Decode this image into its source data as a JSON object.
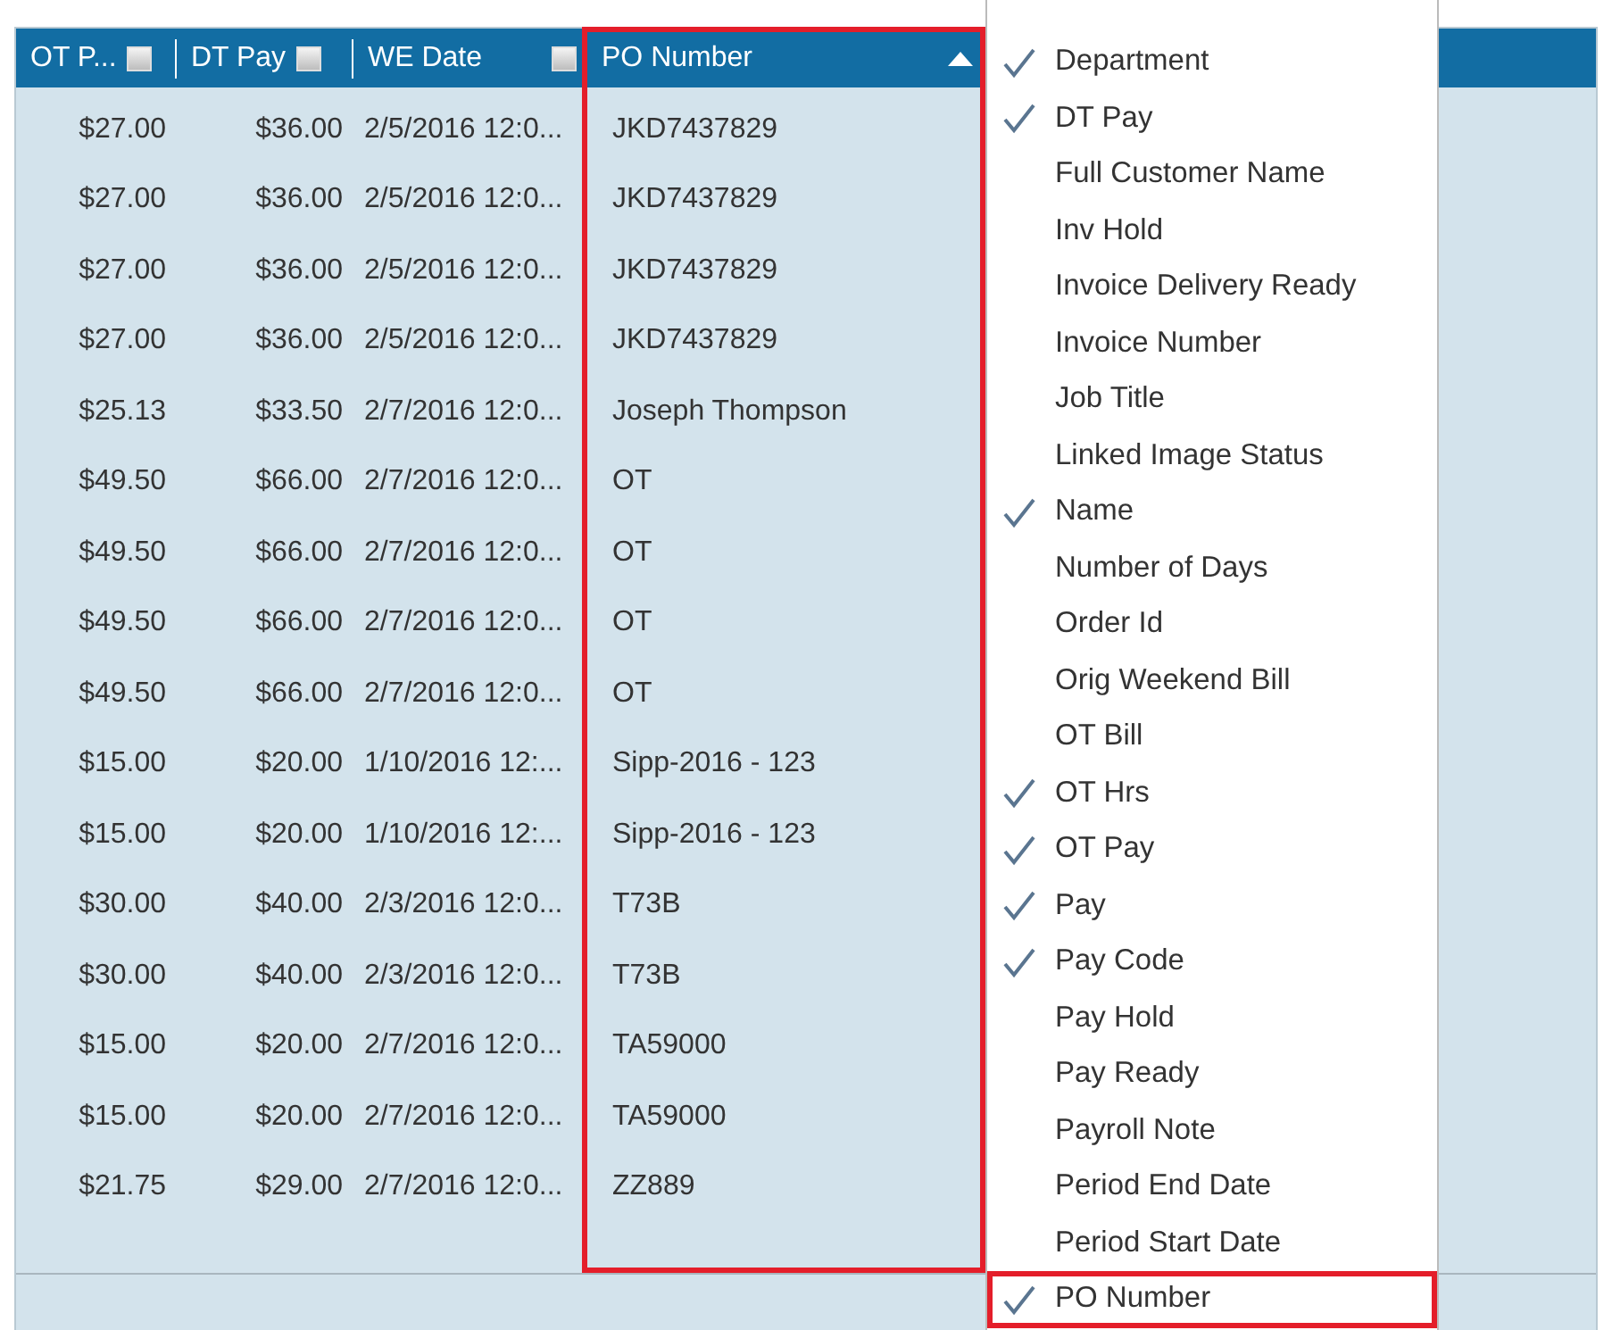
{
  "grid": {
    "columns": [
      {
        "label": "OT P...",
        "filter_icon": true,
        "sorted": false,
        "highlighted": false
      },
      {
        "label": "DT Pay",
        "filter_icon": true,
        "sorted": false,
        "highlighted": false
      },
      {
        "label": "WE Date",
        "filter_icon": true,
        "sorted": false,
        "highlighted": false
      },
      {
        "label": "PO Number",
        "filter_icon": false,
        "sorted": true,
        "highlighted": true
      }
    ],
    "rows": [
      [
        "$27.00",
        "$36.00",
        "2/5/2016 12:0...",
        "JKD7437829"
      ],
      [
        "$27.00",
        "$36.00",
        "2/5/2016 12:0...",
        "JKD7437829"
      ],
      [
        "$27.00",
        "$36.00",
        "2/5/2016 12:0...",
        "JKD7437829"
      ],
      [
        "$27.00",
        "$36.00",
        "2/5/2016 12:0...",
        "JKD7437829"
      ],
      [
        "$25.13",
        "$33.50",
        "2/7/2016 12:0...",
        "Joseph Thompson"
      ],
      [
        "$49.50",
        "$66.00",
        "2/7/2016 12:0...",
        "OT"
      ],
      [
        "$49.50",
        "$66.00",
        "2/7/2016 12:0...",
        "OT"
      ],
      [
        "$49.50",
        "$66.00",
        "2/7/2016 12:0...",
        "OT"
      ],
      [
        "$49.50",
        "$66.00",
        "2/7/2016 12:0...",
        "OT"
      ],
      [
        "$15.00",
        "$20.00",
        "1/10/2016 12:...",
        "Sipp-2016 - 123"
      ],
      [
        "$15.00",
        "$20.00",
        "1/10/2016 12:...",
        "Sipp-2016 - 123"
      ],
      [
        "$30.00",
        "$40.00",
        "2/3/2016 12:0...",
        "T73B"
      ],
      [
        "$30.00",
        "$40.00",
        "2/3/2016 12:0...",
        "T73B"
      ],
      [
        "$15.00",
        "$20.00",
        "2/7/2016 12:0...",
        "TA59000"
      ],
      [
        "$15.00",
        "$20.00",
        "2/7/2016 12:0...",
        "TA59000"
      ],
      [
        "$21.75",
        "$29.00",
        "2/7/2016 12:0...",
        "ZZ889"
      ]
    ]
  },
  "column_menu": {
    "items": [
      {
        "label": "Department",
        "checked": true,
        "highlighted": false
      },
      {
        "label": "DT Pay",
        "checked": true,
        "highlighted": false
      },
      {
        "label": "Full Customer Name",
        "checked": false,
        "highlighted": false
      },
      {
        "label": "Inv Hold",
        "checked": false,
        "highlighted": false
      },
      {
        "label": "Invoice Delivery Ready",
        "checked": false,
        "highlighted": false
      },
      {
        "label": "Invoice Number",
        "checked": false,
        "highlighted": false
      },
      {
        "label": "Job Title",
        "checked": false,
        "highlighted": false
      },
      {
        "label": "Linked Image Status",
        "checked": false,
        "highlighted": false
      },
      {
        "label": "Name",
        "checked": true,
        "highlighted": false
      },
      {
        "label": "Number of Days",
        "checked": false,
        "highlighted": false
      },
      {
        "label": "Order Id",
        "checked": false,
        "highlighted": false
      },
      {
        "label": "Orig Weekend Bill",
        "checked": false,
        "highlighted": false
      },
      {
        "label": "OT Bill",
        "checked": false,
        "highlighted": false
      },
      {
        "label": "OT Hrs",
        "checked": true,
        "highlighted": false
      },
      {
        "label": "OT Pay",
        "checked": true,
        "highlighted": false
      },
      {
        "label": "Pay",
        "checked": true,
        "highlighted": false
      },
      {
        "label": "Pay Code",
        "checked": true,
        "highlighted": false
      },
      {
        "label": "Pay Hold",
        "checked": false,
        "highlighted": false
      },
      {
        "label": "Pay Ready",
        "checked": false,
        "highlighted": false
      },
      {
        "label": "Payroll Note",
        "checked": false,
        "highlighted": false
      },
      {
        "label": "Period End Date",
        "checked": false,
        "highlighted": false
      },
      {
        "label": "Period Start Date",
        "checked": false,
        "highlighted": false
      },
      {
        "label": "PO Number",
        "checked": true,
        "highlighted": true
      }
    ]
  }
}
